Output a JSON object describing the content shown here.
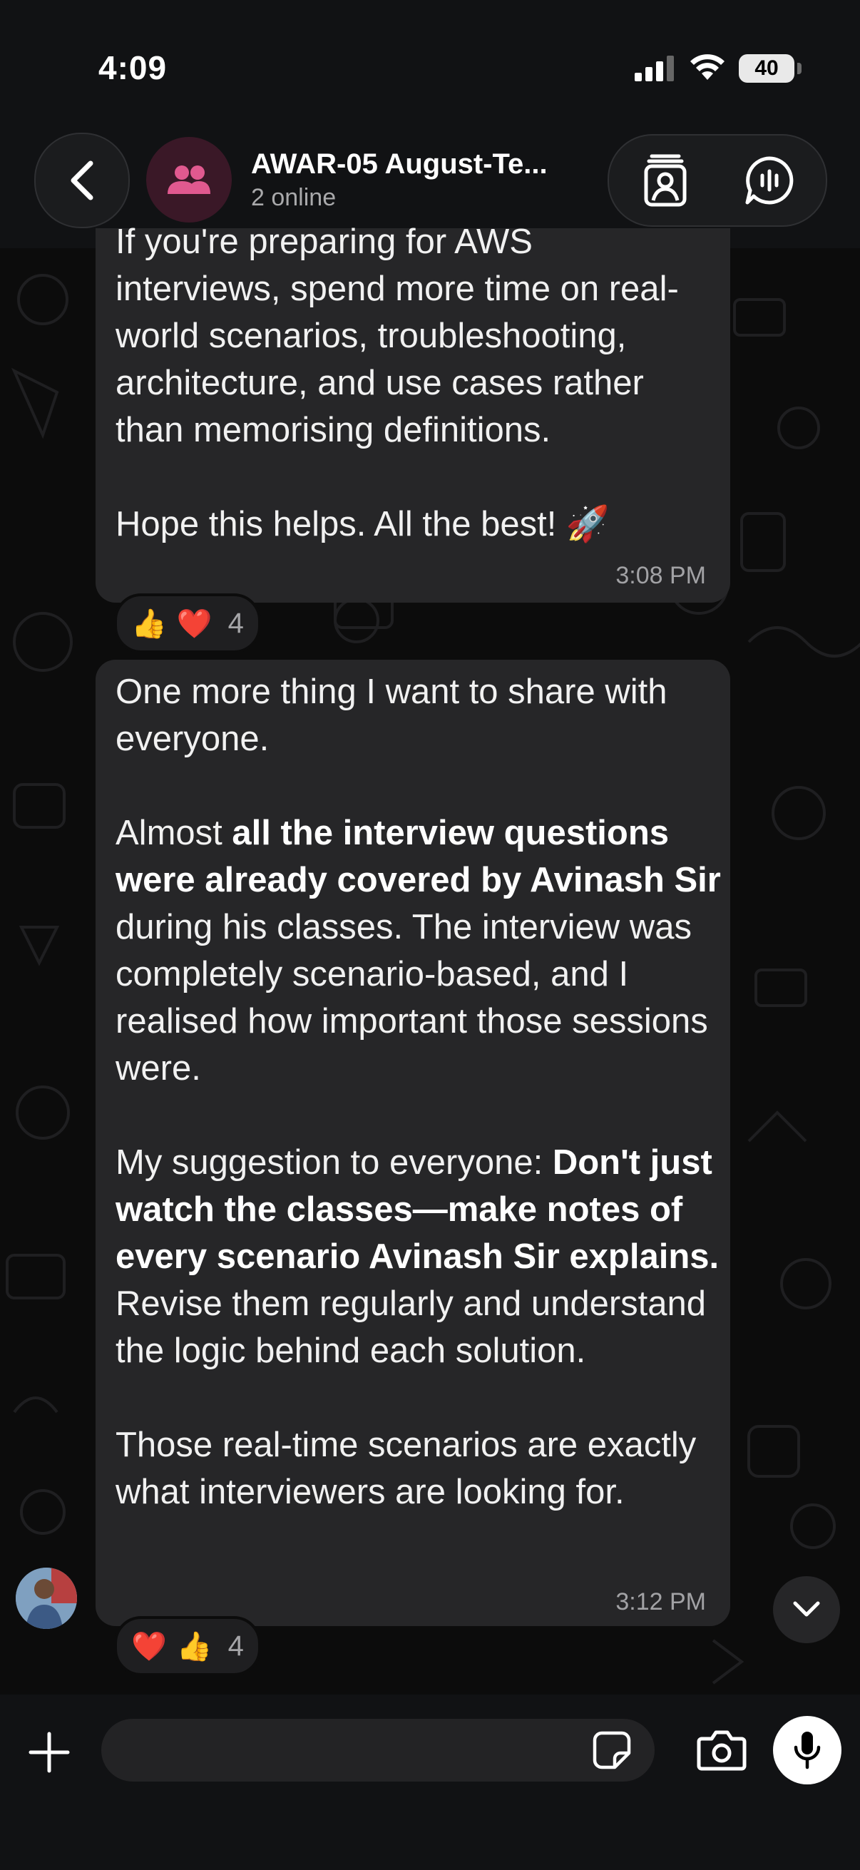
{
  "status_bar": {
    "time": "4:09",
    "battery": "40",
    "icons": [
      "cellular-signal-icon",
      "wifi-icon",
      "battery-icon"
    ]
  },
  "header": {
    "title": "AWAR-05 August-Te...",
    "subtitle": "2 online",
    "avatar_icon": "group-people-icon",
    "icons": [
      "back-chevron-icon",
      "group-contact-card-icon",
      "voice-chat-icon"
    ],
    "accent_color": "#e0598f"
  },
  "messages": [
    {
      "id": "msg-1",
      "lines": [
        "If you're preparing for AWS",
        "interviews, spend more time on real-",
        "world scenarios, troubleshooting,",
        "architecture, and use cases rather",
        "than memorising definitions."
      ],
      "closing": "Hope this helps. All the best! 🚀",
      "time": "3:08 PM",
      "reactions": {
        "emojis": [
          "👍",
          "❤️"
        ],
        "count": "4"
      }
    },
    {
      "id": "msg-2",
      "para1": "One more thing I want to share with everyone.",
      "para2": {
        "pre": "Almost ",
        "bold": "all the interview questions were already covered by Avinash Sir",
        "post": " during his classes. The interview was completely scenario-based, and I realised how important those sessions were."
      },
      "para3": {
        "pre": "My suggestion to everyone: ",
        "bold": "Don't just watch the classes—make notes of every scenario Avinash Sir explains.",
        "post": " Revise them regularly and understand the logic behind each solution."
      },
      "para4": "Those real-time scenarios are exactly what interviewers are looking for.",
      "time": "3:12 PM",
      "reactions": {
        "emojis": [
          "❤️",
          "👍"
        ],
        "count": "4"
      }
    }
  ],
  "input_bar": {
    "placeholder": "",
    "icons": [
      "plus-icon",
      "sticker-icon",
      "camera-icon",
      "microphone-icon"
    ]
  },
  "colors": {
    "bubble": "#262628",
    "background": "#0c0c0c",
    "bar": "#111214"
  }
}
